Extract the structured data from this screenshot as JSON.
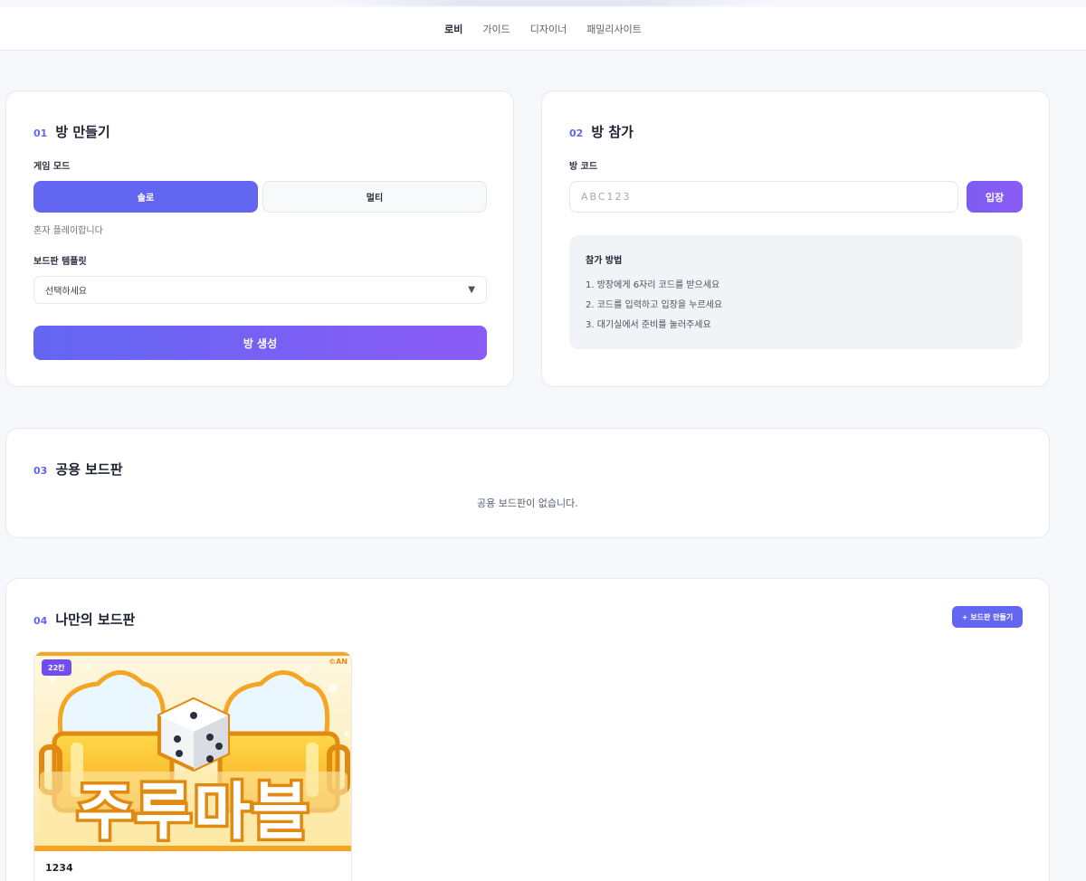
{
  "nav": {
    "items": [
      {
        "label": "로비",
        "active": true
      },
      {
        "label": "가이드",
        "active": false
      },
      {
        "label": "디자이너",
        "active": false
      },
      {
        "label": "패밀리사이트",
        "active": false
      }
    ]
  },
  "create_room": {
    "num": "01",
    "title": "방 만들기",
    "mode_label": "게임 모드",
    "modes": [
      {
        "label": "솔로",
        "selected": true
      },
      {
        "label": "멀티",
        "selected": false
      }
    ],
    "mode_hint": "혼자 플레이합니다",
    "template_label": "보드판 템플릿",
    "template_selected": "선택하세요",
    "create_button": "방 생성"
  },
  "join_room": {
    "num": "02",
    "title": "방 참가",
    "code_label": "방 코드",
    "code_placeholder": "ABC123",
    "enter_button": "입장",
    "howto_title": "참가 방법",
    "steps": [
      "1. 방장에게 6자리 코드를 받으세요",
      "2. 코드를 입력하고 입장을 누르세요",
      "3. 대기실에서 준비를 눌러주세요"
    ]
  },
  "public_boards": {
    "num": "03",
    "title": "공용 보드판",
    "empty_text": "공용 보드판이 없습니다."
  },
  "my_boards": {
    "num": "04",
    "title": "나만의 보드판",
    "new_button": "+ 보드판 만들기",
    "boards": [
      {
        "badge": "22칸",
        "artwork_text": "주루마블",
        "corner_text": "©AN",
        "name": "1234"
      }
    ]
  },
  "colors": {
    "accent": "#6366f1",
    "accent_purple": "#8b5cf6",
    "thumb_orange": "#f4a623",
    "thumb_yellow": "#fde9a6"
  }
}
